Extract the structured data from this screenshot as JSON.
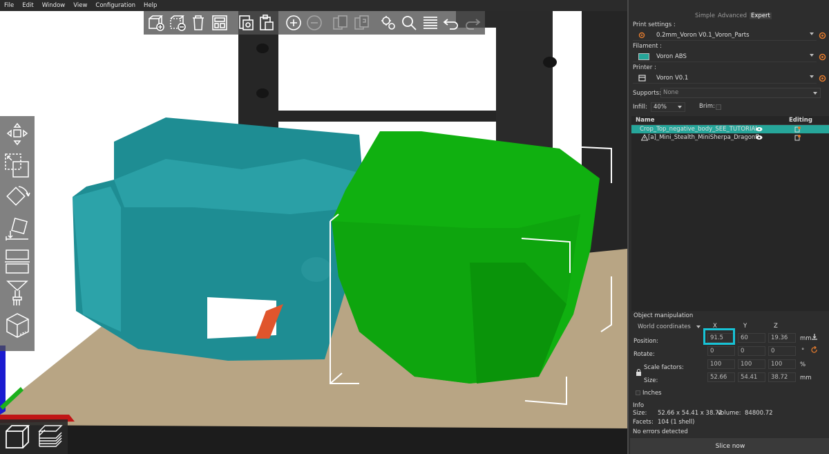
{
  "menu": [
    "File",
    "Edit",
    "Window",
    "View",
    "Configuration",
    "Help"
  ],
  "modes": {
    "simple": "Simple",
    "advanced": "Advanced",
    "expert": "Expert"
  },
  "print_settings": {
    "label": "Print settings :",
    "value": "0.2mm_Voron V0.1_Voron_Parts"
  },
  "filament": {
    "label": "Filament :",
    "value": "Voron ABS",
    "swatch": "#26a69a"
  },
  "printer": {
    "label": "Printer :",
    "value": "Voron V0.1"
  },
  "supports": {
    "label": "Supports:",
    "value": "None"
  },
  "infill": {
    "label": "Infill:",
    "value": "40%"
  },
  "brim": {
    "label": "Brim:"
  },
  "object_list": {
    "col_name": "Name",
    "col_editing": "Editing",
    "rows": [
      {
        "name": "Crop_Top_negative_body_SEE_TUTORIAL"
      },
      {
        "name": "[a]_Mini_Stealth_MiniSherpa_Dragonfl"
      }
    ]
  },
  "object_manipulation": {
    "title": "Object manipulation",
    "coord_system": "World coordinates",
    "axes": [
      "X",
      "Y",
      "Z"
    ],
    "position": {
      "label": "Position:",
      "x": "91.5",
      "y": "60",
      "z": "19.36",
      "unit": "mm"
    },
    "rotate": {
      "label": "Rotate:",
      "x": "0",
      "y": "0",
      "z": "0",
      "unit": "°"
    },
    "scale": {
      "label": "Scale factors:",
      "x": "100",
      "y": "100",
      "z": "100",
      "unit": "%"
    },
    "size": {
      "label": "Size:",
      "x": "52.66",
      "y": "54.41",
      "z": "38.72",
      "unit": "mm"
    },
    "inches": "Inches"
  },
  "info": {
    "title": "Info",
    "size_label": "Size:",
    "size_value": "52.66 x 54.41 x 38.72",
    "volume_label": "Volume:",
    "volume_value": "84800.72",
    "facets_label": "Facets:",
    "facets_value": "104 (1 shell)",
    "errors": "No errors detected"
  },
  "slice_button": "Slice now",
  "colors": {
    "accent": "#26a69a",
    "highlight": "#17c3d6",
    "object_selected": "#10b010",
    "object_model": "#1e8d93",
    "bed": "#b8a584"
  }
}
